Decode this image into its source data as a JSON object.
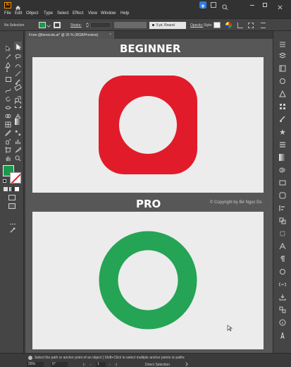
{
  "menu": [
    "File",
    "Edit",
    "Object",
    "Type",
    "Select",
    "Effect",
    "View",
    "Window",
    "Help"
  ],
  "app_logo": "Ai",
  "control": {
    "selection": "No Selection",
    "stroke_label": "Stroke:",
    "brush": "5 pt. Round",
    "opacity_label": "Opacity:",
    "style_label": "Style:"
  },
  "doc_tab": "From @benocds.ai* @ 25 % (RGB/Preview)",
  "artboards": {
    "top_title": "BEGINNER",
    "bottom_title": "PRO",
    "copyright": "© Copyright by Bé Ngọc Ds"
  },
  "status": {
    "hint": "Select the path or anchor point of an object  |  Shift+Click to select multiple anchor points or paths",
    "zoom": "25%",
    "rotation": "0°",
    "page": "1",
    "tool": "Direct Selection"
  },
  "colors": {
    "red_shape": "#e21b2a",
    "green_ring": "#25a455",
    "fill_swatch": "#1a9a4c",
    "accent": "#2f7ee0"
  }
}
